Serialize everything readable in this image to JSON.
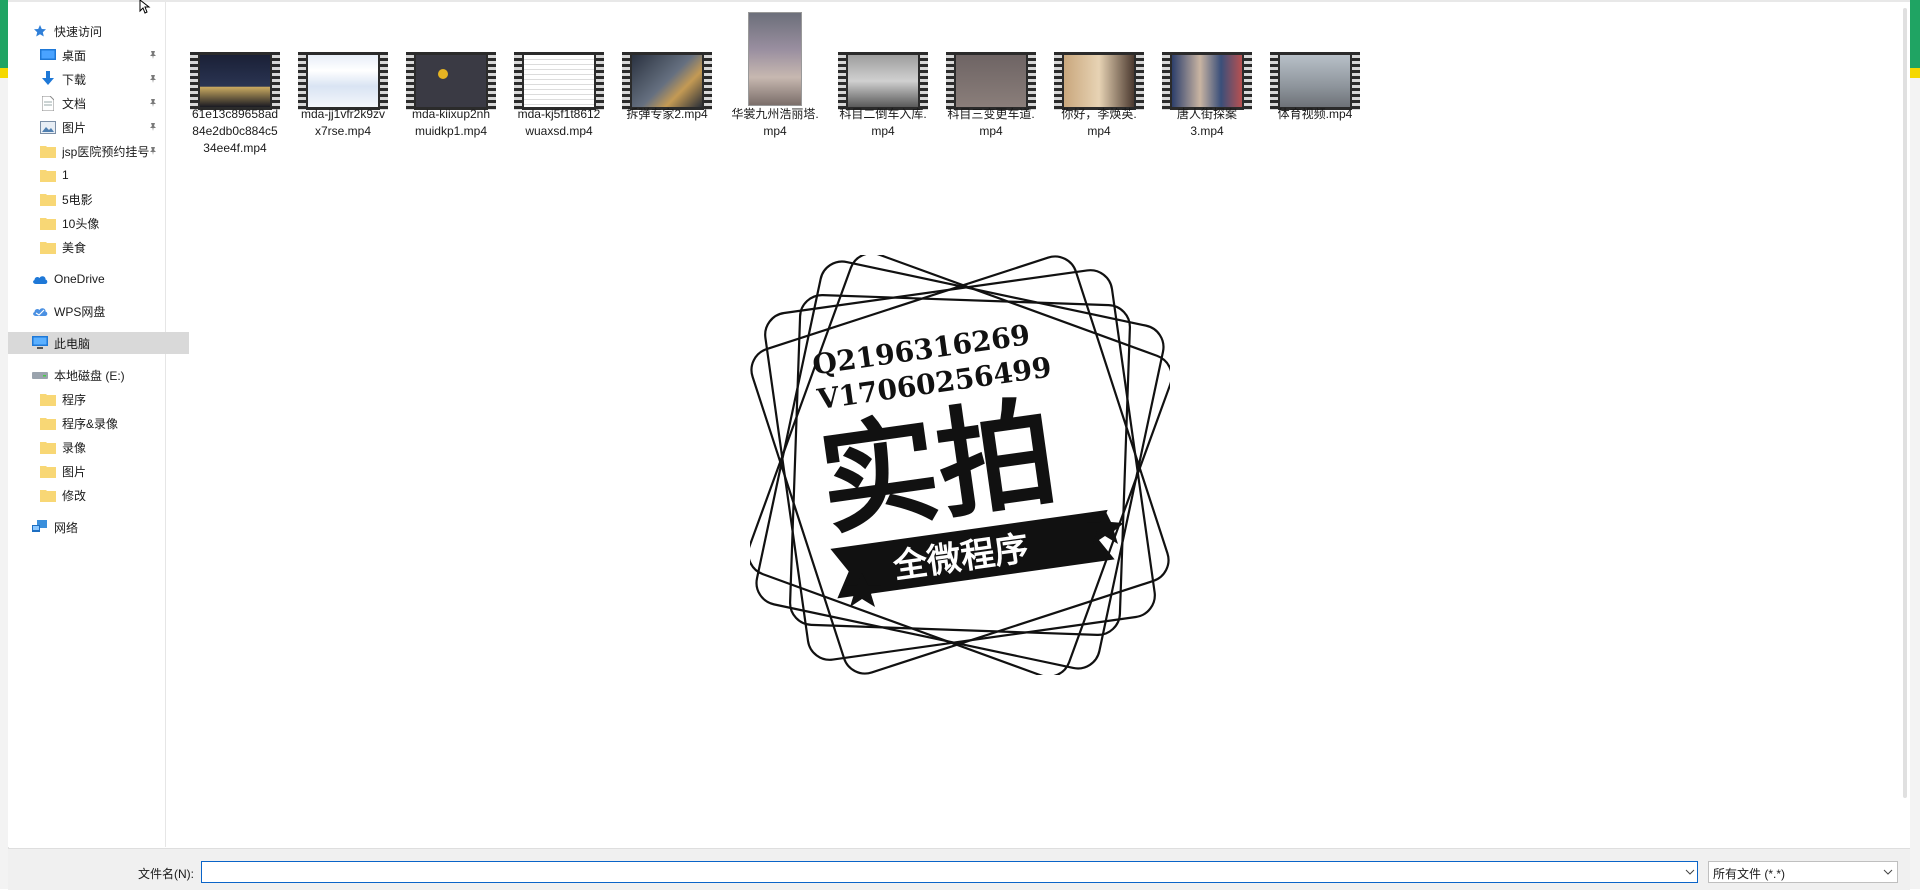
{
  "nav": {
    "quick_access": "快速访问",
    "quick_items": [
      {
        "label": "桌面",
        "icon": "desktop-icon",
        "pinned": true
      },
      {
        "label": "下载",
        "icon": "download-icon",
        "pinned": true
      },
      {
        "label": "文档",
        "icon": "document-icon",
        "pinned": true
      },
      {
        "label": "图片",
        "icon": "pictures-icon",
        "pinned": true
      },
      {
        "label": "jsp医院预约挂号",
        "icon": "folder-icon",
        "pinned": true
      },
      {
        "label": "1",
        "icon": "folder-icon",
        "pinned": false
      },
      {
        "label": "5电影",
        "icon": "folder-icon",
        "pinned": false
      },
      {
        "label": "10头像",
        "icon": "folder-icon",
        "pinned": false
      },
      {
        "label": "美食",
        "icon": "folder-icon",
        "pinned": false
      }
    ],
    "onedrive": "OneDrive",
    "wps": "WPS网盘",
    "this_pc": "此电脑",
    "local_disk": "本地磁盘 (E:)",
    "disk_items": [
      "程序",
      "程序&录像",
      "录像",
      "图片",
      "修改"
    ],
    "network": "网络"
  },
  "files": [
    {
      "name": "61e13c89658ad84e2db0c884c534ee4f.mp4",
      "lines": [
        "61e13c89658ad",
        "84e2db0c884c5",
        "34ee4f.mp4"
      ],
      "thumb": "night-city"
    },
    {
      "name": "mda-jj1vfr2k9zvx7rse.mp4",
      "lines": [
        "mda-jj1vfr2k9zv",
        "x7rse.mp4"
      ],
      "thumb": "webpage"
    },
    {
      "name": "mda-kiixup2nhmuidkp1.mp4",
      "lines": [
        "mda-kiixup2nh",
        "muidkp1.mp4"
      ],
      "thumb": "map"
    },
    {
      "name": "mda-kj5f1t8612wuaxsd.mp4",
      "lines": [
        "mda-kj5f1t8612",
        "wuaxsd.mp4"
      ],
      "thumb": "document"
    },
    {
      "name": "拆弹专家2.mp4",
      "lines": [
        "拆弹专家2.mp4"
      ],
      "thumb": "street"
    },
    {
      "name": "华裳九州浩丽塔.mp4",
      "lines": [
        "华裳九州浩丽塔.",
        "mp4"
      ],
      "thumb": "portrait"
    },
    {
      "name": "科目二倒车入库.mp4",
      "lines": [
        "科目二倒车入库.",
        "mp4"
      ],
      "thumb": "car-interior"
    },
    {
      "name": "科目三变更车道.mp4",
      "lines": [
        "科目三变更车道.",
        "mp4"
      ],
      "thumb": "title-card"
    },
    {
      "name": "你好，李焕英.mp4",
      "lines": [
        "你好，李焕英.",
        "mp4"
      ],
      "thumb": "people"
    },
    {
      "name": "唐人街探案3.mp4",
      "lines": [
        "唐人街探案",
        "3.mp4"
      ],
      "thumb": "crowd"
    },
    {
      "name": "体育视频.mp4",
      "lines": [
        "体育视频.mp4"
      ],
      "thumb": "sports"
    }
  ],
  "stamp": {
    "line1": "Q2196316269",
    "line2": "V17060256499",
    "big": "实拍",
    "banner": "全微程序"
  },
  "bottom": {
    "filename_label": "文件名(N):",
    "filename_value": "",
    "filter_value": "所有文件 (*.*)"
  },
  "colors": {
    "selection": "#d9d9d9",
    "accent_border": "#0a64c8",
    "edge_green": "#1fa463",
    "edge_yellow": "#f5d800"
  }
}
